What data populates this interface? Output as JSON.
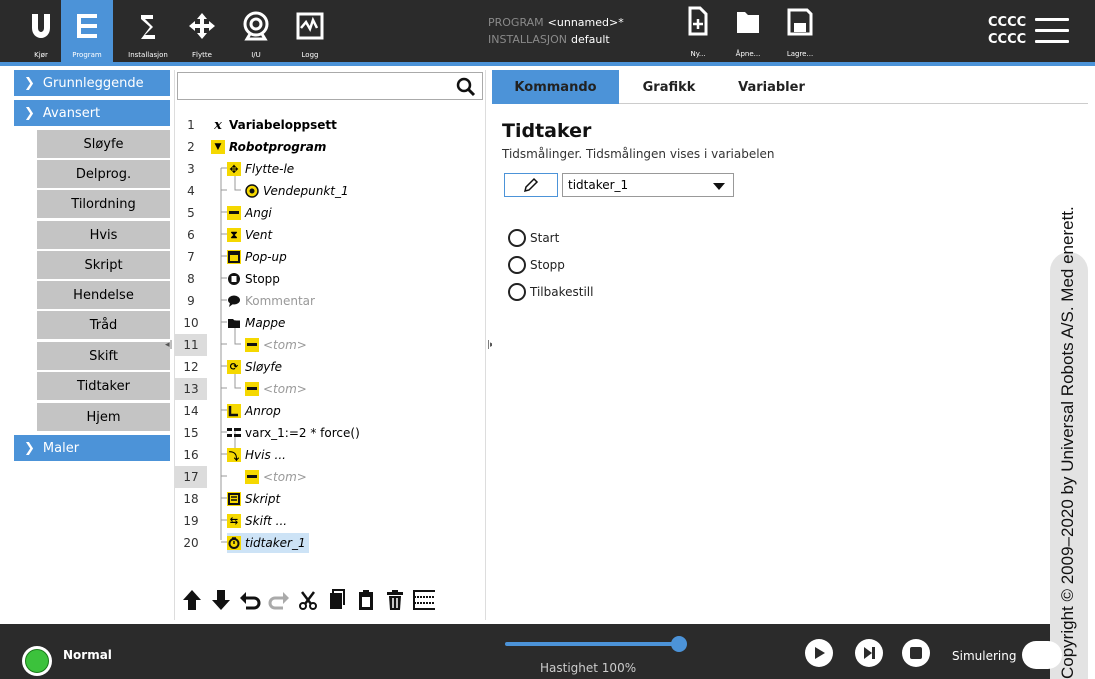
{
  "header": {
    "nav": [
      {
        "label": "Kjør",
        "icon": "ur-logo-icon"
      },
      {
        "label": "Program",
        "icon": "program-icon"
      },
      {
        "label": "Installasjon",
        "icon": "installation-icon"
      },
      {
        "label": "Flytte",
        "icon": "move-icon"
      },
      {
        "label": "I/U",
        "icon": "io-icon"
      },
      {
        "label": "Logg",
        "icon": "log-icon"
      }
    ],
    "program_label": "PROGRAM",
    "program_value": "<unnamed>*",
    "installation_label": "INSTALLASJON",
    "installation_value": "default",
    "file_buttons": {
      "new": "Ny...",
      "open": "Åpne...",
      "save": "Lagre..."
    },
    "cccc_1": "CCCC",
    "cccc_2": "CCCC"
  },
  "left_panel": {
    "basic": "Grunnleggende",
    "advanced": "Avansert",
    "templates": "Maler",
    "advanced_items": [
      "Sløyfe",
      "Delprog.",
      "Tilordning",
      "Hvis",
      "Skript",
      "Hendelse",
      "Tråd",
      "Skift",
      "Tidtaker",
      "Hjem"
    ]
  },
  "tree": {
    "search_placeholder": "",
    "rows": [
      {
        "n": "1",
        "text": "Variabeloppsett"
      },
      {
        "n": "2",
        "text": "Robotprogram"
      },
      {
        "n": "3",
        "text": "Flytte-le"
      },
      {
        "n": "4",
        "text": "Vendepunkt_1"
      },
      {
        "n": "5",
        "text": "Angi"
      },
      {
        "n": "6",
        "text": "Vent"
      },
      {
        "n": "7",
        "text": "Pop-up"
      },
      {
        "n": "8",
        "text": "Stopp"
      },
      {
        "n": "9",
        "text": "Kommentar"
      },
      {
        "n": "10",
        "text": "Mappe"
      },
      {
        "n": "11",
        "text": "<tom>"
      },
      {
        "n": "12",
        "text": "Sløyfe"
      },
      {
        "n": "13",
        "text": "<tom>"
      },
      {
        "n": "14",
        "text": "Anrop"
      },
      {
        "n": "15",
        "text": "varx_1:=2 * force()"
      },
      {
        "n": "16",
        "text": "Hvis ..."
      },
      {
        "n": "17",
        "text": "<tom>"
      },
      {
        "n": "18",
        "text": "Skript"
      },
      {
        "n": "19",
        "text": "Skift ..."
      },
      {
        "n": "20",
        "text": "tidtaker_1"
      }
    ]
  },
  "right_panel": {
    "tabs": [
      "Kommando",
      "Grafikk",
      "Variabler"
    ],
    "title": "Tidtaker",
    "description": "Tidsmålinger. Tidsmålingen vises i variabelen",
    "selected_variable": "tidtaker_1",
    "options": [
      "Start",
      "Stopp",
      "Tilbakestill"
    ]
  },
  "copyright": "Copyright © 2009–2020 by Universal Robots A/S. Med enerett.",
  "footer": {
    "status": "Normal",
    "speed_label": "Hastighet 100%",
    "speed_value": 100,
    "simulation_label": "Simulering"
  },
  "colors": {
    "accent": "#4c93d8",
    "header_bg": "#2b2b2b",
    "status_ok": "#3cc23c"
  }
}
